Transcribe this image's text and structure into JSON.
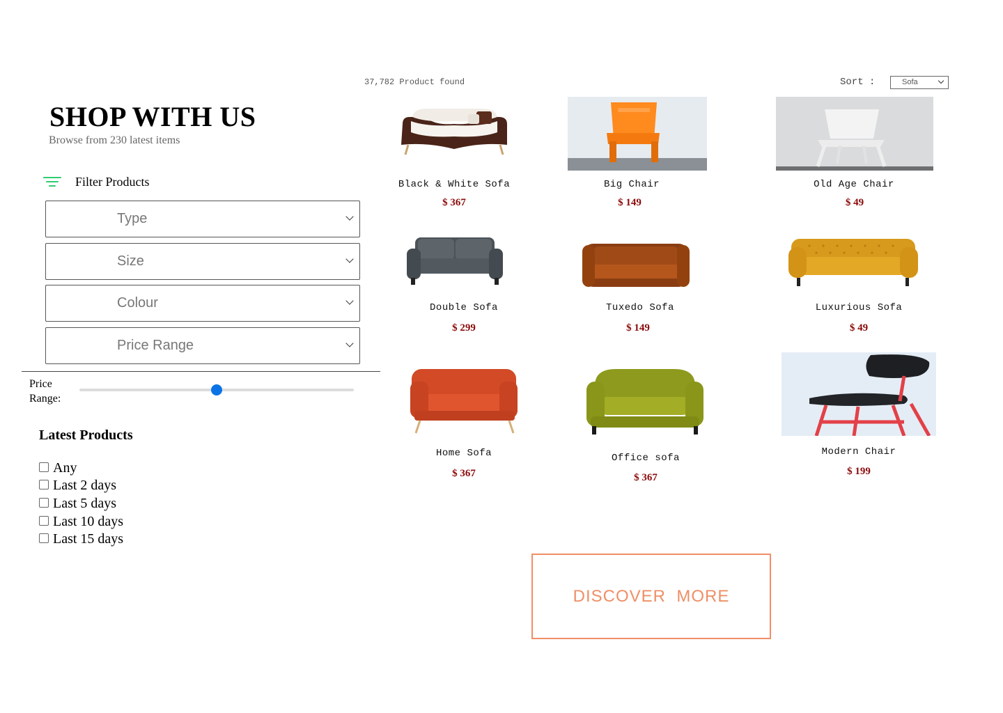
{
  "header": {
    "title": "SHOP WITH US",
    "subtitle": "Browse from 230 latest items"
  },
  "filters": {
    "heading": "Filter Products",
    "icon": "filter-lines-icon",
    "selects": [
      "Type",
      "Size",
      "Colour",
      "Price Range"
    ],
    "price_label": "Price Range:",
    "price_slider_fraction": 0.5
  },
  "latest": {
    "heading": "Latest Products",
    "options": [
      "Any",
      "Last 2 days",
      "Last 5 days",
      "Last 10 days",
      "Last 15 days"
    ]
  },
  "results": {
    "count_text": "37,782 Product found",
    "sort_label": "Sort :",
    "sort_value": "Sofa"
  },
  "products": [
    {
      "name": "Black & White Sofa",
      "price": "$ 367"
    },
    {
      "name": "Big Chair",
      "price": "$ 149"
    },
    {
      "name": "Old Age Chair",
      "price": "$ 49"
    },
    {
      "name": "Double Sofa",
      "price": "$ 299"
    },
    {
      "name": "Tuxedo Sofa",
      "price": "$ 149"
    },
    {
      "name": "Luxurious Sofa",
      "price": "$ 49"
    },
    {
      "name": "Home Sofa",
      "price": "$ 367"
    },
    {
      "name": "Office sofa",
      "price": "$ 367"
    },
    {
      "name": "Modern Chair",
      "price": "$ 199"
    }
  ],
  "cta": {
    "label": "DISCOVER  MORE"
  },
  "colors": {
    "accent": "#ef8f66",
    "price": "#8b0a0a",
    "slider": "#0a74e6",
    "filter_icon": "#2ecc71"
  }
}
